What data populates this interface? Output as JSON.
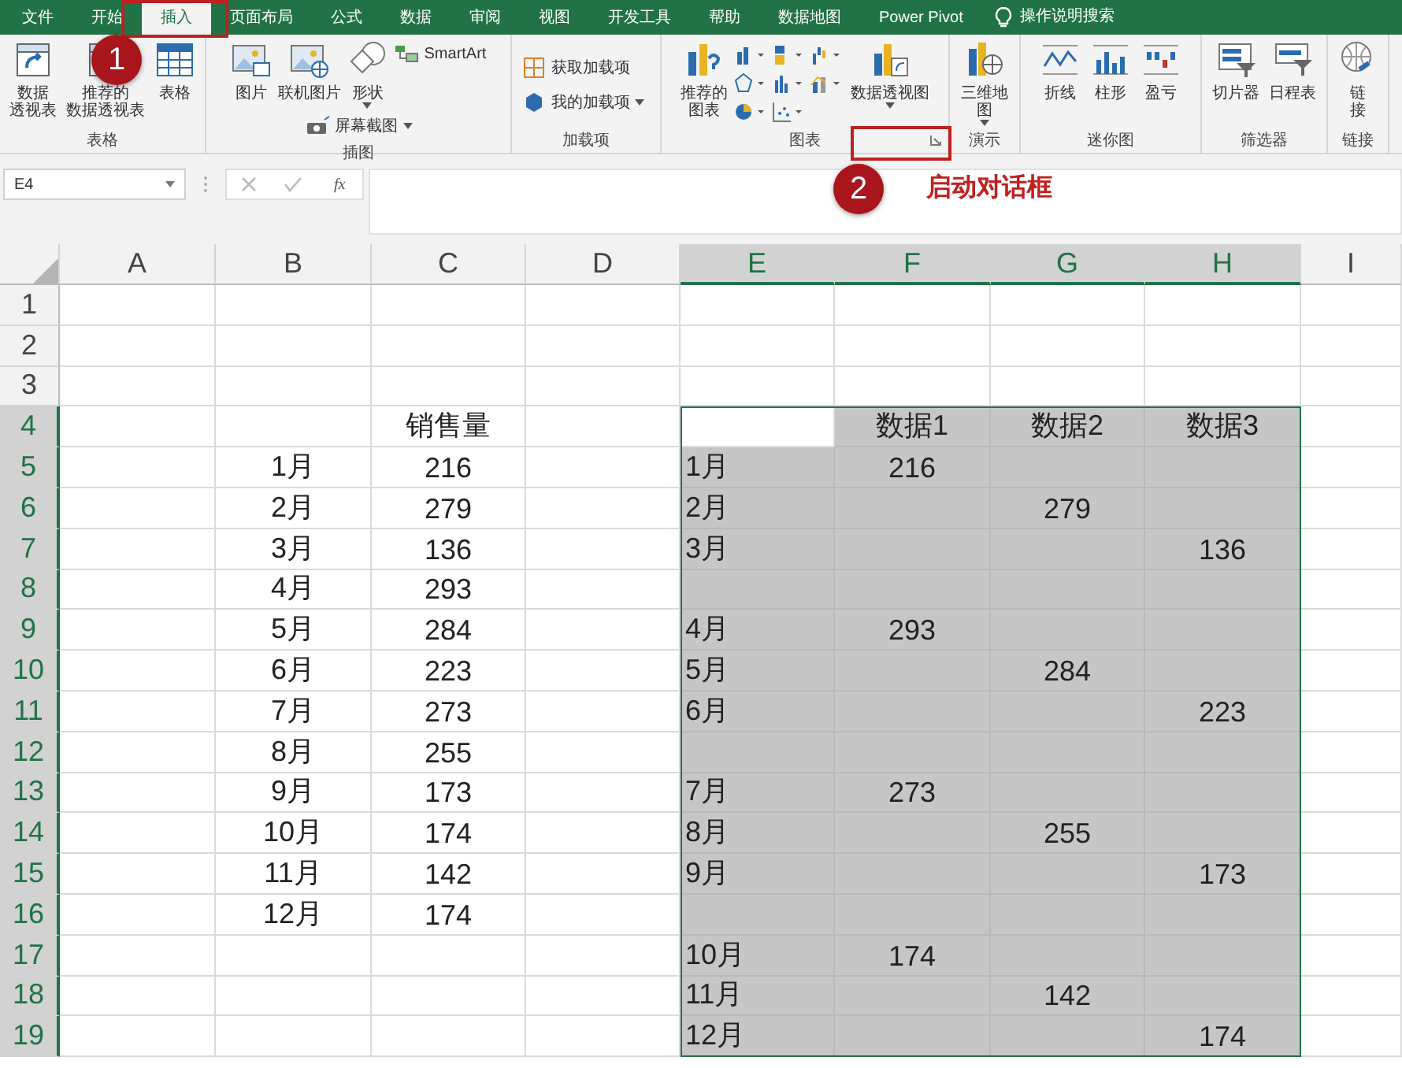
{
  "menu_tabs": [
    {
      "label": "文件",
      "selected": false
    },
    {
      "label": "开始",
      "selected": false
    },
    {
      "label": "插入",
      "selected": true
    },
    {
      "label": "页面布局",
      "selected": false
    },
    {
      "label": "公式",
      "selected": false
    },
    {
      "label": "数据",
      "selected": false
    },
    {
      "label": "审阅",
      "selected": false
    },
    {
      "label": "视图",
      "selected": false
    },
    {
      "label": "开发工具",
      "selected": false
    },
    {
      "label": "帮助",
      "selected": false
    },
    {
      "label": "数据地图",
      "selected": false
    },
    {
      "label": "Power Pivot",
      "selected": false
    }
  ],
  "tell_me": {
    "label": "操作说明搜索"
  },
  "ribbon_groups": [
    {
      "label": "表格",
      "items": [
        {
          "kind": "large",
          "label": "数据透视表"
        },
        {
          "kind": "large",
          "label": "推荐的数据透视表"
        },
        {
          "kind": "large",
          "label": "表格"
        }
      ]
    },
    {
      "label": "插图",
      "items": [
        {
          "kind": "large",
          "label": "图片"
        },
        {
          "kind": "large",
          "label": "联机图片"
        },
        {
          "kind": "large",
          "label": "形状",
          "dropdown": true
        },
        {
          "kind": "small",
          "label": "SmartArt"
        },
        {
          "kind": "small",
          "label": "屏幕截图",
          "dropdown": true
        }
      ]
    },
    {
      "label": "加载项",
      "items": [
        {
          "kind": "small",
          "label": "获取加载项"
        },
        {
          "kind": "small",
          "label": "我的加载项",
          "dropdown": true
        }
      ]
    },
    {
      "label": "图表",
      "launcher": true,
      "items": [
        {
          "kind": "large",
          "label": "推荐的图表"
        },
        {
          "kind": "gallery"
        },
        {
          "kind": "large",
          "label": "数据透视图",
          "dropdown": true
        }
      ]
    },
    {
      "label": "演示",
      "items": [
        {
          "kind": "large",
          "label": "三维地图",
          "dropdown": true
        }
      ]
    },
    {
      "label": "迷你图",
      "items": [
        {
          "kind": "large",
          "label": "折线"
        },
        {
          "kind": "large",
          "label": "柱形"
        },
        {
          "kind": "large",
          "label": "盈亏"
        }
      ]
    },
    {
      "label": "筛选器",
      "items": [
        {
          "kind": "large",
          "label": "切片器"
        },
        {
          "kind": "large",
          "label": "日程表"
        }
      ]
    },
    {
      "label": "链接",
      "items": [
        {
          "kind": "large",
          "label": "链接"
        }
      ]
    }
  ],
  "name_box": {
    "value": "E4"
  },
  "formula_buttons": {
    "function": "fx"
  },
  "callouts": [
    {
      "number": "1"
    },
    {
      "number": "2",
      "text": "启动对话框"
    }
  ],
  "columns": [
    {
      "label": "A",
      "selected": false
    },
    {
      "label": "B",
      "selected": false
    },
    {
      "label": "C",
      "selected": false
    },
    {
      "label": "D",
      "selected": false
    },
    {
      "label": "E",
      "selected": true
    },
    {
      "label": "F",
      "selected": true
    },
    {
      "label": "G",
      "selected": true
    },
    {
      "label": "H",
      "selected": true
    },
    {
      "label": "I",
      "selected": false
    }
  ],
  "rows": [
    {
      "header": "1",
      "selected": false,
      "cells": {}
    },
    {
      "header": "2",
      "selected": false,
      "cells": {}
    },
    {
      "header": "3",
      "selected": false,
      "cells": {}
    },
    {
      "header": "4",
      "selected": true,
      "cells": {
        "C": "销售量",
        "F": "数据1",
        "G": "数据2",
        "H": "数据3"
      }
    },
    {
      "header": "5",
      "selected": true,
      "cells": {
        "B": "1月",
        "C": "216",
        "E": "1月",
        "F": "216"
      }
    },
    {
      "header": "6",
      "selected": true,
      "cells": {
        "B": "2月",
        "C": "279",
        "E": "2月",
        "G": "279"
      }
    },
    {
      "header": "7",
      "selected": true,
      "cells": {
        "B": "3月",
        "C": "136",
        "E": "3月",
        "H": "136"
      }
    },
    {
      "header": "8",
      "selected": true,
      "cells": {
        "B": "4月",
        "C": "293"
      }
    },
    {
      "header": "9",
      "selected": true,
      "cells": {
        "B": "5月",
        "C": "284",
        "E": "4月",
        "F": "293"
      }
    },
    {
      "header": "10",
      "selected": true,
      "cells": {
        "B": "6月",
        "C": "223",
        "E": "5月",
        "G": "284"
      }
    },
    {
      "header": "11",
      "selected": true,
      "cells": {
        "B": "7月",
        "C": "273",
        "E": "6月",
        "H": "223"
      }
    },
    {
      "header": "12",
      "selected": true,
      "cells": {
        "B": "8月",
        "C": "255"
      }
    },
    {
      "header": "13",
      "selected": true,
      "cells": {
        "B": "9月",
        "C": "173",
        "E": "7月",
        "F": "273"
      }
    },
    {
      "header": "14",
      "selected": true,
      "cells": {
        "B": "10月",
        "C": "174",
        "E": "8月",
        "G": "255"
      }
    },
    {
      "header": "15",
      "selected": true,
      "cells": {
        "B": "11月",
        "C": "142",
        "E": "9月",
        "H": "173"
      }
    },
    {
      "header": "16",
      "selected": true,
      "cells": {
        "B": "12月",
        "C": "174"
      }
    },
    {
      "header": "17",
      "selected": true,
      "cells": {
        "E": "10月",
        "F": "174"
      }
    },
    {
      "header": "18",
      "selected": true,
      "cells": {
        "E": "11月",
        "G": "142"
      }
    },
    {
      "header": "19",
      "selected": true,
      "cells": {
        "E": "12月",
        "H": "174"
      }
    }
  ]
}
